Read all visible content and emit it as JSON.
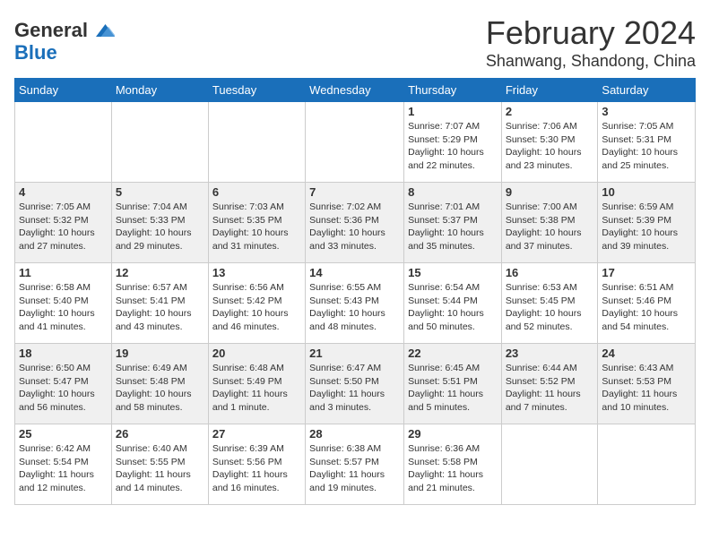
{
  "logo": {
    "text_general": "General",
    "text_blue": "Blue"
  },
  "title": "February 2024",
  "location": "Shanwang, Shandong, China",
  "days_of_week": [
    "Sunday",
    "Monday",
    "Tuesday",
    "Wednesday",
    "Thursday",
    "Friday",
    "Saturday"
  ],
  "weeks": [
    {
      "days": [
        {
          "num": "",
          "empty": true
        },
        {
          "num": "",
          "empty": true
        },
        {
          "num": "",
          "empty": true
        },
        {
          "num": "",
          "empty": true
        },
        {
          "num": "1",
          "sunrise": "7:07 AM",
          "sunset": "5:29 PM",
          "daylight": "10 hours and 22 minutes."
        },
        {
          "num": "2",
          "sunrise": "7:06 AM",
          "sunset": "5:30 PM",
          "daylight": "10 hours and 23 minutes."
        },
        {
          "num": "3",
          "sunrise": "7:05 AM",
          "sunset": "5:31 PM",
          "daylight": "10 hours and 25 minutes."
        }
      ]
    },
    {
      "days": [
        {
          "num": "4",
          "sunrise": "7:05 AM",
          "sunset": "5:32 PM",
          "daylight": "10 hours and 27 minutes."
        },
        {
          "num": "5",
          "sunrise": "7:04 AM",
          "sunset": "5:33 PM",
          "daylight": "10 hours and 29 minutes."
        },
        {
          "num": "6",
          "sunrise": "7:03 AM",
          "sunset": "5:35 PM",
          "daylight": "10 hours and 31 minutes."
        },
        {
          "num": "7",
          "sunrise": "7:02 AM",
          "sunset": "5:36 PM",
          "daylight": "10 hours and 33 minutes."
        },
        {
          "num": "8",
          "sunrise": "7:01 AM",
          "sunset": "5:37 PM",
          "daylight": "10 hours and 35 minutes."
        },
        {
          "num": "9",
          "sunrise": "7:00 AM",
          "sunset": "5:38 PM",
          "daylight": "10 hours and 37 minutes."
        },
        {
          "num": "10",
          "sunrise": "6:59 AM",
          "sunset": "5:39 PM",
          "daylight": "10 hours and 39 minutes."
        }
      ]
    },
    {
      "days": [
        {
          "num": "11",
          "sunrise": "6:58 AM",
          "sunset": "5:40 PM",
          "daylight": "10 hours and 41 minutes."
        },
        {
          "num": "12",
          "sunrise": "6:57 AM",
          "sunset": "5:41 PM",
          "daylight": "10 hours and 43 minutes."
        },
        {
          "num": "13",
          "sunrise": "6:56 AM",
          "sunset": "5:42 PM",
          "daylight": "10 hours and 46 minutes."
        },
        {
          "num": "14",
          "sunrise": "6:55 AM",
          "sunset": "5:43 PM",
          "daylight": "10 hours and 48 minutes."
        },
        {
          "num": "15",
          "sunrise": "6:54 AM",
          "sunset": "5:44 PM",
          "daylight": "10 hours and 50 minutes."
        },
        {
          "num": "16",
          "sunrise": "6:53 AM",
          "sunset": "5:45 PM",
          "daylight": "10 hours and 52 minutes."
        },
        {
          "num": "17",
          "sunrise": "6:51 AM",
          "sunset": "5:46 PM",
          "daylight": "10 hours and 54 minutes."
        }
      ]
    },
    {
      "days": [
        {
          "num": "18",
          "sunrise": "6:50 AM",
          "sunset": "5:47 PM",
          "daylight": "10 hours and 56 minutes."
        },
        {
          "num": "19",
          "sunrise": "6:49 AM",
          "sunset": "5:48 PM",
          "daylight": "10 hours and 58 minutes."
        },
        {
          "num": "20",
          "sunrise": "6:48 AM",
          "sunset": "5:49 PM",
          "daylight": "11 hours and 1 minute."
        },
        {
          "num": "21",
          "sunrise": "6:47 AM",
          "sunset": "5:50 PM",
          "daylight": "11 hours and 3 minutes."
        },
        {
          "num": "22",
          "sunrise": "6:45 AM",
          "sunset": "5:51 PM",
          "daylight": "11 hours and 5 minutes."
        },
        {
          "num": "23",
          "sunrise": "6:44 AM",
          "sunset": "5:52 PM",
          "daylight": "11 hours and 7 minutes."
        },
        {
          "num": "24",
          "sunrise": "6:43 AM",
          "sunset": "5:53 PM",
          "daylight": "11 hours and 10 minutes."
        }
      ]
    },
    {
      "days": [
        {
          "num": "25",
          "sunrise": "6:42 AM",
          "sunset": "5:54 PM",
          "daylight": "11 hours and 12 minutes."
        },
        {
          "num": "26",
          "sunrise": "6:40 AM",
          "sunset": "5:55 PM",
          "daylight": "11 hours and 14 minutes."
        },
        {
          "num": "27",
          "sunrise": "6:39 AM",
          "sunset": "5:56 PM",
          "daylight": "11 hours and 16 minutes."
        },
        {
          "num": "28",
          "sunrise": "6:38 AM",
          "sunset": "5:57 PM",
          "daylight": "11 hours and 19 minutes."
        },
        {
          "num": "29",
          "sunrise": "6:36 AM",
          "sunset": "5:58 PM",
          "daylight": "11 hours and 21 minutes."
        },
        {
          "num": "",
          "empty": true
        },
        {
          "num": "",
          "empty": true
        }
      ]
    }
  ]
}
